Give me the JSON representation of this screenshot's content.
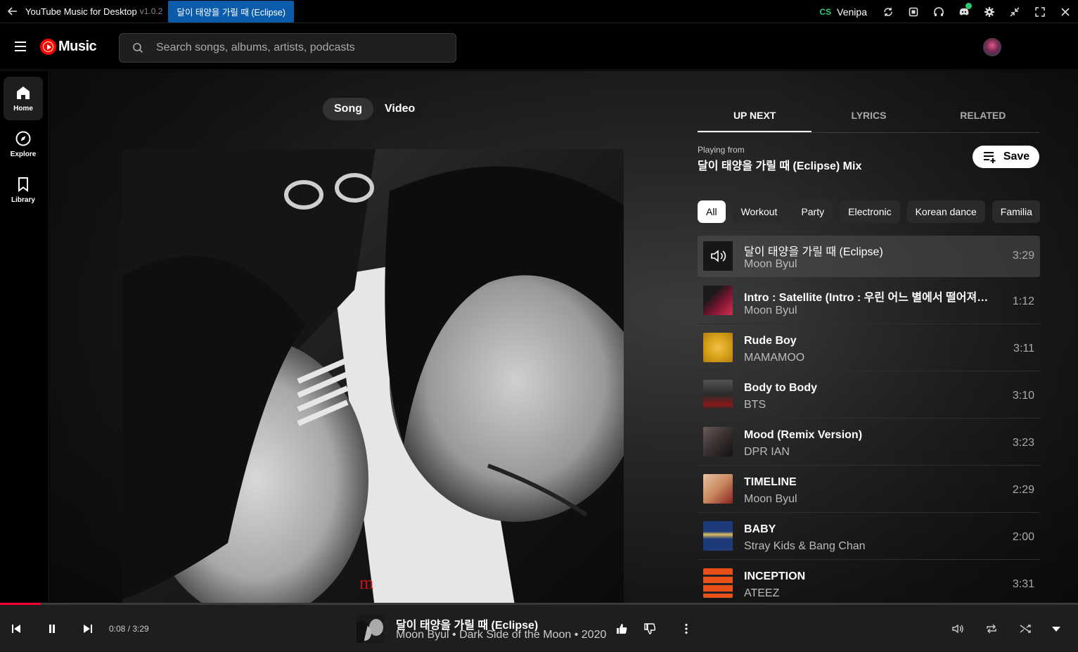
{
  "titlebar": {
    "app_name": "YouTube Music for Desktop",
    "version": "v1.0.2",
    "current_song": "달이 태양을 가릴 때 (Eclipse)",
    "user_logo": "CS",
    "user_name": "Venipa",
    "icons": [
      "refresh-icon",
      "extension-icon",
      "headphones-icon",
      "discord-icon",
      "gear-icon",
      "minimize-icon",
      "fullscreen-icon",
      "close-icon"
    ]
  },
  "header": {
    "logo_text": "Music",
    "search_placeholder": "Search songs, albums, artists, podcasts"
  },
  "sidebar": {
    "items": [
      {
        "label": "Home",
        "icon": "home-icon",
        "active": true
      },
      {
        "label": "Explore",
        "icon": "compass-icon",
        "active": false
      },
      {
        "label": "Library",
        "icon": "bookmark-icon",
        "active": false
      }
    ]
  },
  "player_page": {
    "toggle": {
      "song": "Song",
      "video": "Video",
      "selected": "Song"
    }
  },
  "right_panel": {
    "tabs": [
      "UP NEXT",
      "LYRICS",
      "RELATED"
    ],
    "active_tab": "UP NEXT",
    "playing_from_label": "Playing from",
    "playlist_name": "달이 태양을 가릴 때 (Eclipse) Mix",
    "save_label": "Save",
    "chips": [
      "All",
      "Workout",
      "Party",
      "Electronic",
      "Korean dance",
      "Familia"
    ],
    "queue": [
      {
        "title": "달이 태양을 가릴 때 (Eclipse)",
        "artist": "Moon Byul",
        "duration": "3:29",
        "current": true,
        "thumb_color": "#222222"
      },
      {
        "title": "Intro : Satellite (Intro : 우린 어느 별에서 떨어져 만났길래)",
        "artist": "Moon Byul",
        "duration": "1:12",
        "current": false,
        "thumb_color": "#7a1530"
      },
      {
        "title": "Rude Boy",
        "artist": "MAMAMOO",
        "duration": "3:11",
        "current": false,
        "thumb_color": "#d9a319"
      },
      {
        "title": "Body to Body",
        "artist": "BTS",
        "duration": "3:10",
        "current": false,
        "thumb_color": "#2a2a2a"
      },
      {
        "title": "Mood (Remix Version)",
        "artist": "DPR IAN",
        "duration": "3:23",
        "current": false,
        "thumb_color": "#3a3030"
      },
      {
        "title": "TIMELINE",
        "artist": "Moon Byul",
        "duration": "2:29",
        "current": false,
        "thumb_color": "#c98a60"
      },
      {
        "title": "BABY",
        "artist": "Stray Kids & Bang Chan",
        "duration": "2:00",
        "current": false,
        "thumb_color": "#1d3b7a"
      },
      {
        "title": "INCEPTION",
        "artist": "ATEEZ",
        "duration": "3:31",
        "current": false,
        "thumb_color": "#e8501a"
      }
    ]
  },
  "player_bar": {
    "time": "0:08 / 3:29",
    "progress_fraction": 0.038,
    "title": "달이 태양을 가릴 때 (Eclipse)",
    "subtitle": "Moon Byul • Dark Side of the Moon • 2020"
  },
  "colors": {
    "accent": "#ff0033",
    "song_badge": "#0b5cad",
    "discord_status": "#2ecc71"
  }
}
